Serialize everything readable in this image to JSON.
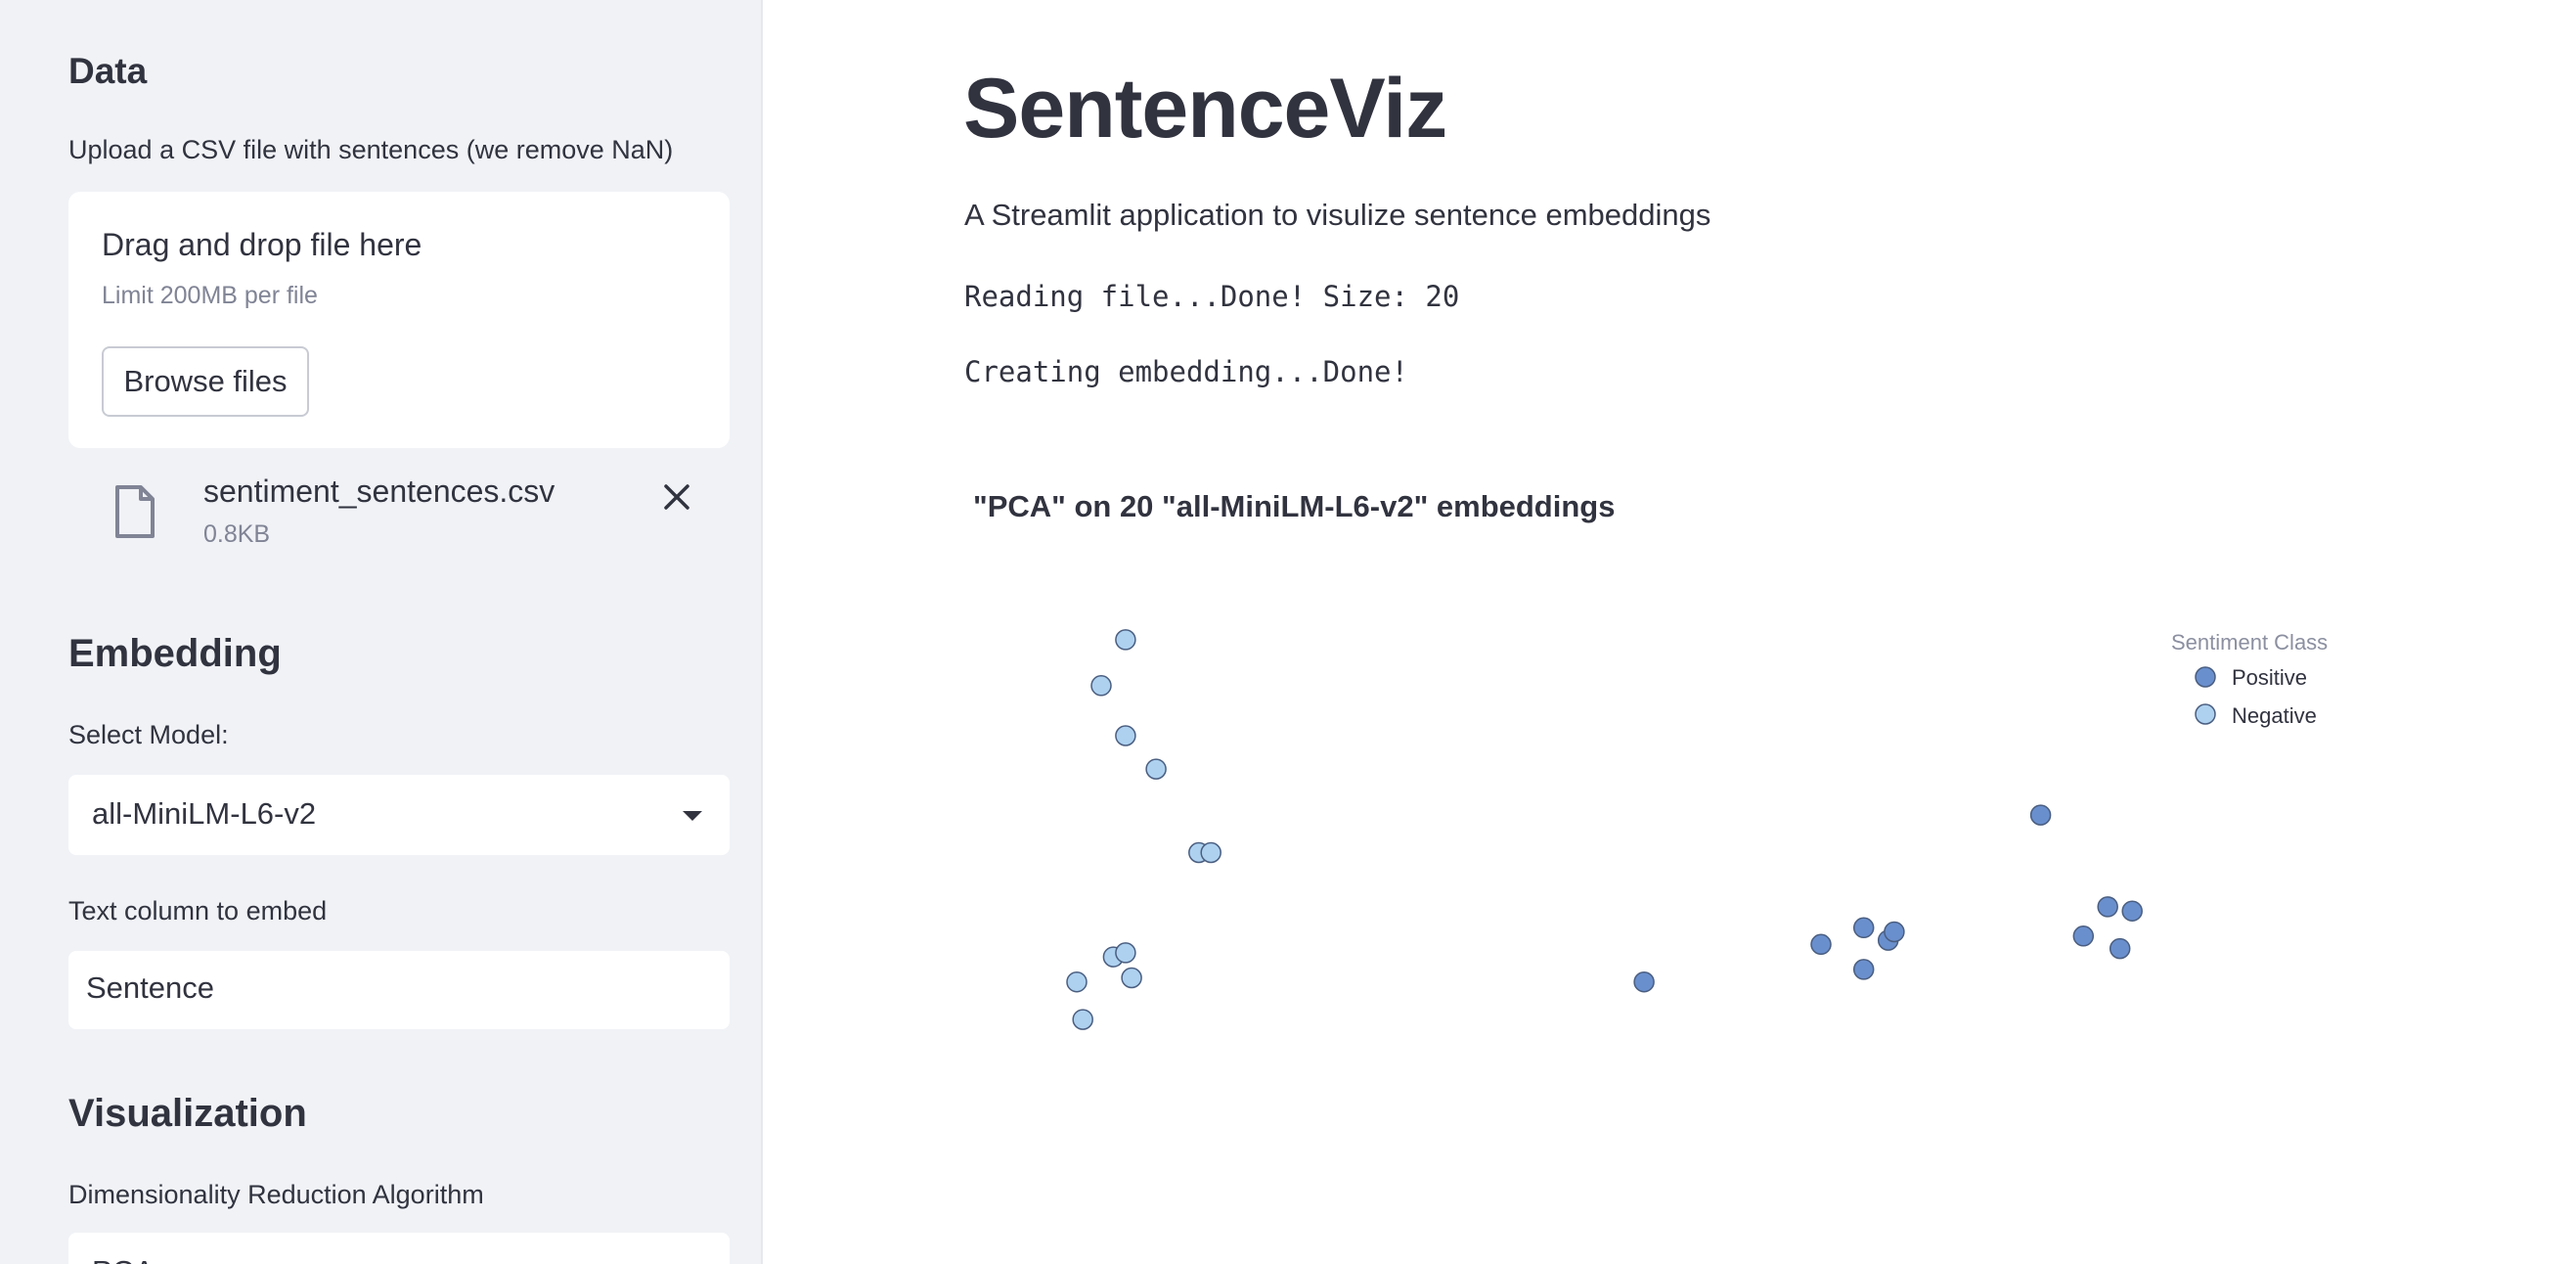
{
  "sidebar": {
    "data_heading": "Data",
    "upload_label": "Upload a CSV file with sentences (we remove NaN)",
    "dropzone_title": "Drag and drop file here",
    "dropzone_limit": "Limit 200MB per file",
    "browse_button": "Browse files",
    "file_name": "sentiment_sentences.csv",
    "file_size": "0.8KB",
    "embedding_heading": "Embedding",
    "model_label": "Select Model:",
    "model_value": "all-MiniLM-L6-v2",
    "text_column_label": "Text column to embed",
    "text_column_value": "Sentence",
    "visualization_heading": "Visualization",
    "algorithm_label": "Dimensionality Reduction Algorithm",
    "algorithm_value": "PCA"
  },
  "main": {
    "title": "SentenceViz",
    "subtitle": "A Streamlit application to visulize sentence embeddings",
    "status_reading": "Reading file...Done! Size: 20",
    "status_embedding": "Creating embedding...Done!"
  },
  "colors": {
    "positive": "#6a8fcd",
    "negative": "#aed1f0",
    "sidebar_bg": "#f0f2f6"
  },
  "chart_data": {
    "type": "scatter",
    "title": "\"PCA\" on 20 \"all-MiniLM-L6-v2\" embeddings",
    "legend_title": "Sentiment Class",
    "legend_position": "top-right",
    "grid": false,
    "xlim": [
      -1.0,
      1.1
    ],
    "ylim": [
      -0.8,
      0.7
    ],
    "series": [
      {
        "name": "Positive",
        "color": "#6a8fcd",
        "points": [
          {
            "x": 0.79,
            "y": 0.06
          },
          {
            "x": 0.9,
            "y": -0.16
          },
          {
            "x": 0.86,
            "y": -0.23
          },
          {
            "x": 0.43,
            "y": -0.25
          },
          {
            "x": 0.5,
            "y": -0.21
          },
          {
            "x": 0.54,
            "y": -0.24
          },
          {
            "x": 0.55,
            "y": -0.22
          },
          {
            "x": 0.5,
            "y": -0.31
          },
          {
            "x": 0.94,
            "y": -0.17
          },
          {
            "x": 0.92,
            "y": -0.26
          },
          {
            "x": 0.14,
            "y": -0.34
          }
        ]
      },
      {
        "name": "Negative",
        "color": "#aed1f0",
        "points": [
          {
            "x": -0.71,
            "y": 0.48
          },
          {
            "x": -0.75,
            "y": 0.37
          },
          {
            "x": -0.71,
            "y": 0.25
          },
          {
            "x": -0.66,
            "y": 0.17
          },
          {
            "x": -0.59,
            "y": -0.03
          },
          {
            "x": -0.57,
            "y": -0.03
          },
          {
            "x": -0.73,
            "y": -0.28
          },
          {
            "x": -0.71,
            "y": -0.27
          },
          {
            "x": -0.7,
            "y": -0.33
          },
          {
            "x": -0.79,
            "y": -0.34
          },
          {
            "x": -0.78,
            "y": -0.43
          }
        ]
      }
    ]
  }
}
